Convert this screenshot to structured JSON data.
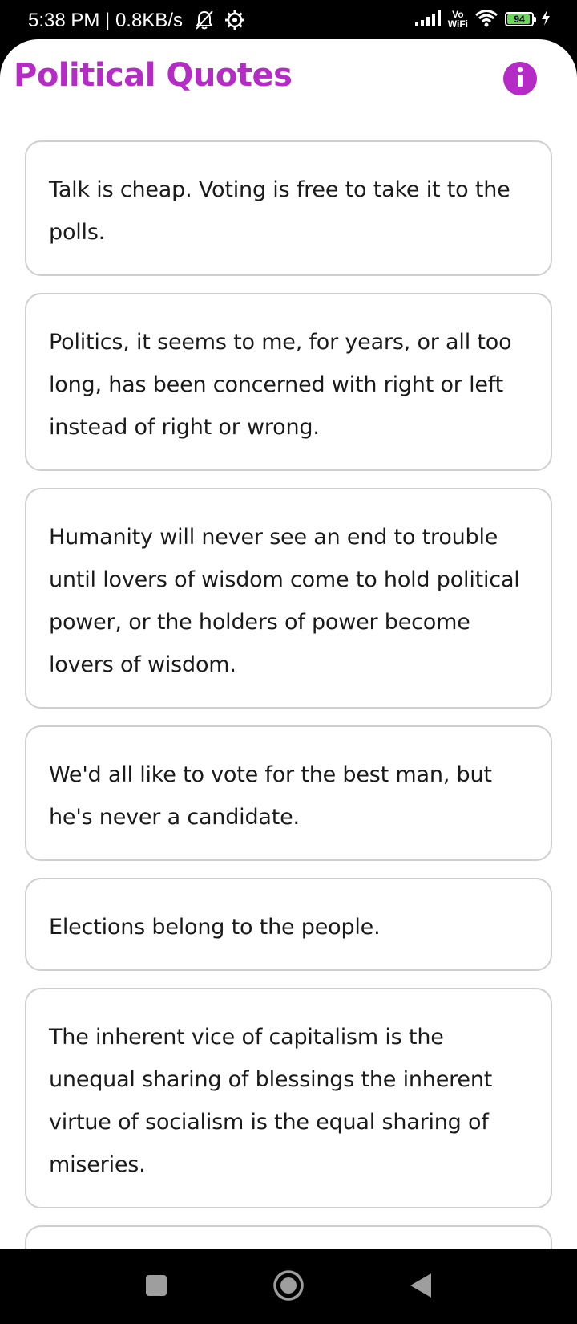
{
  "status_bar": {
    "time_speed": "5:38 PM | 0.8KB/s",
    "wifi_label_top": "Vo",
    "wifi_label_bottom": "WiFi",
    "battery_level": "94",
    "icons": [
      "mute-bell-icon",
      "settings-gear-icon",
      "signal-icon",
      "wifi-icon",
      "battery-icon",
      "charging-bolt-icon"
    ]
  },
  "app": {
    "title": "Political Quotes",
    "info_icon": "info-icon",
    "accent_color": "#b52bc6"
  },
  "quotes": [
    "Talk is cheap. Voting is free to take it to the polls.",
    "Politics, it seems to me, for years, or all too long, has been concerned with right or left instead of right or wrong.",
    "Humanity will never see an end to trouble until lovers of wisdom come to hold political power, or the holders of power become lovers of wisdom.",
    "We'd all like to vote for the best man, but he's never a candidate.",
    "Elections belong to the people.",
    "The inherent vice of capitalism is the unequal sharing of blessings the inherent virtue of socialism is the equal sharing of miseries."
  ],
  "nav_bar": {
    "icons": [
      "recents-square-icon",
      "home-circle-icon",
      "back-triangle-icon"
    ]
  }
}
